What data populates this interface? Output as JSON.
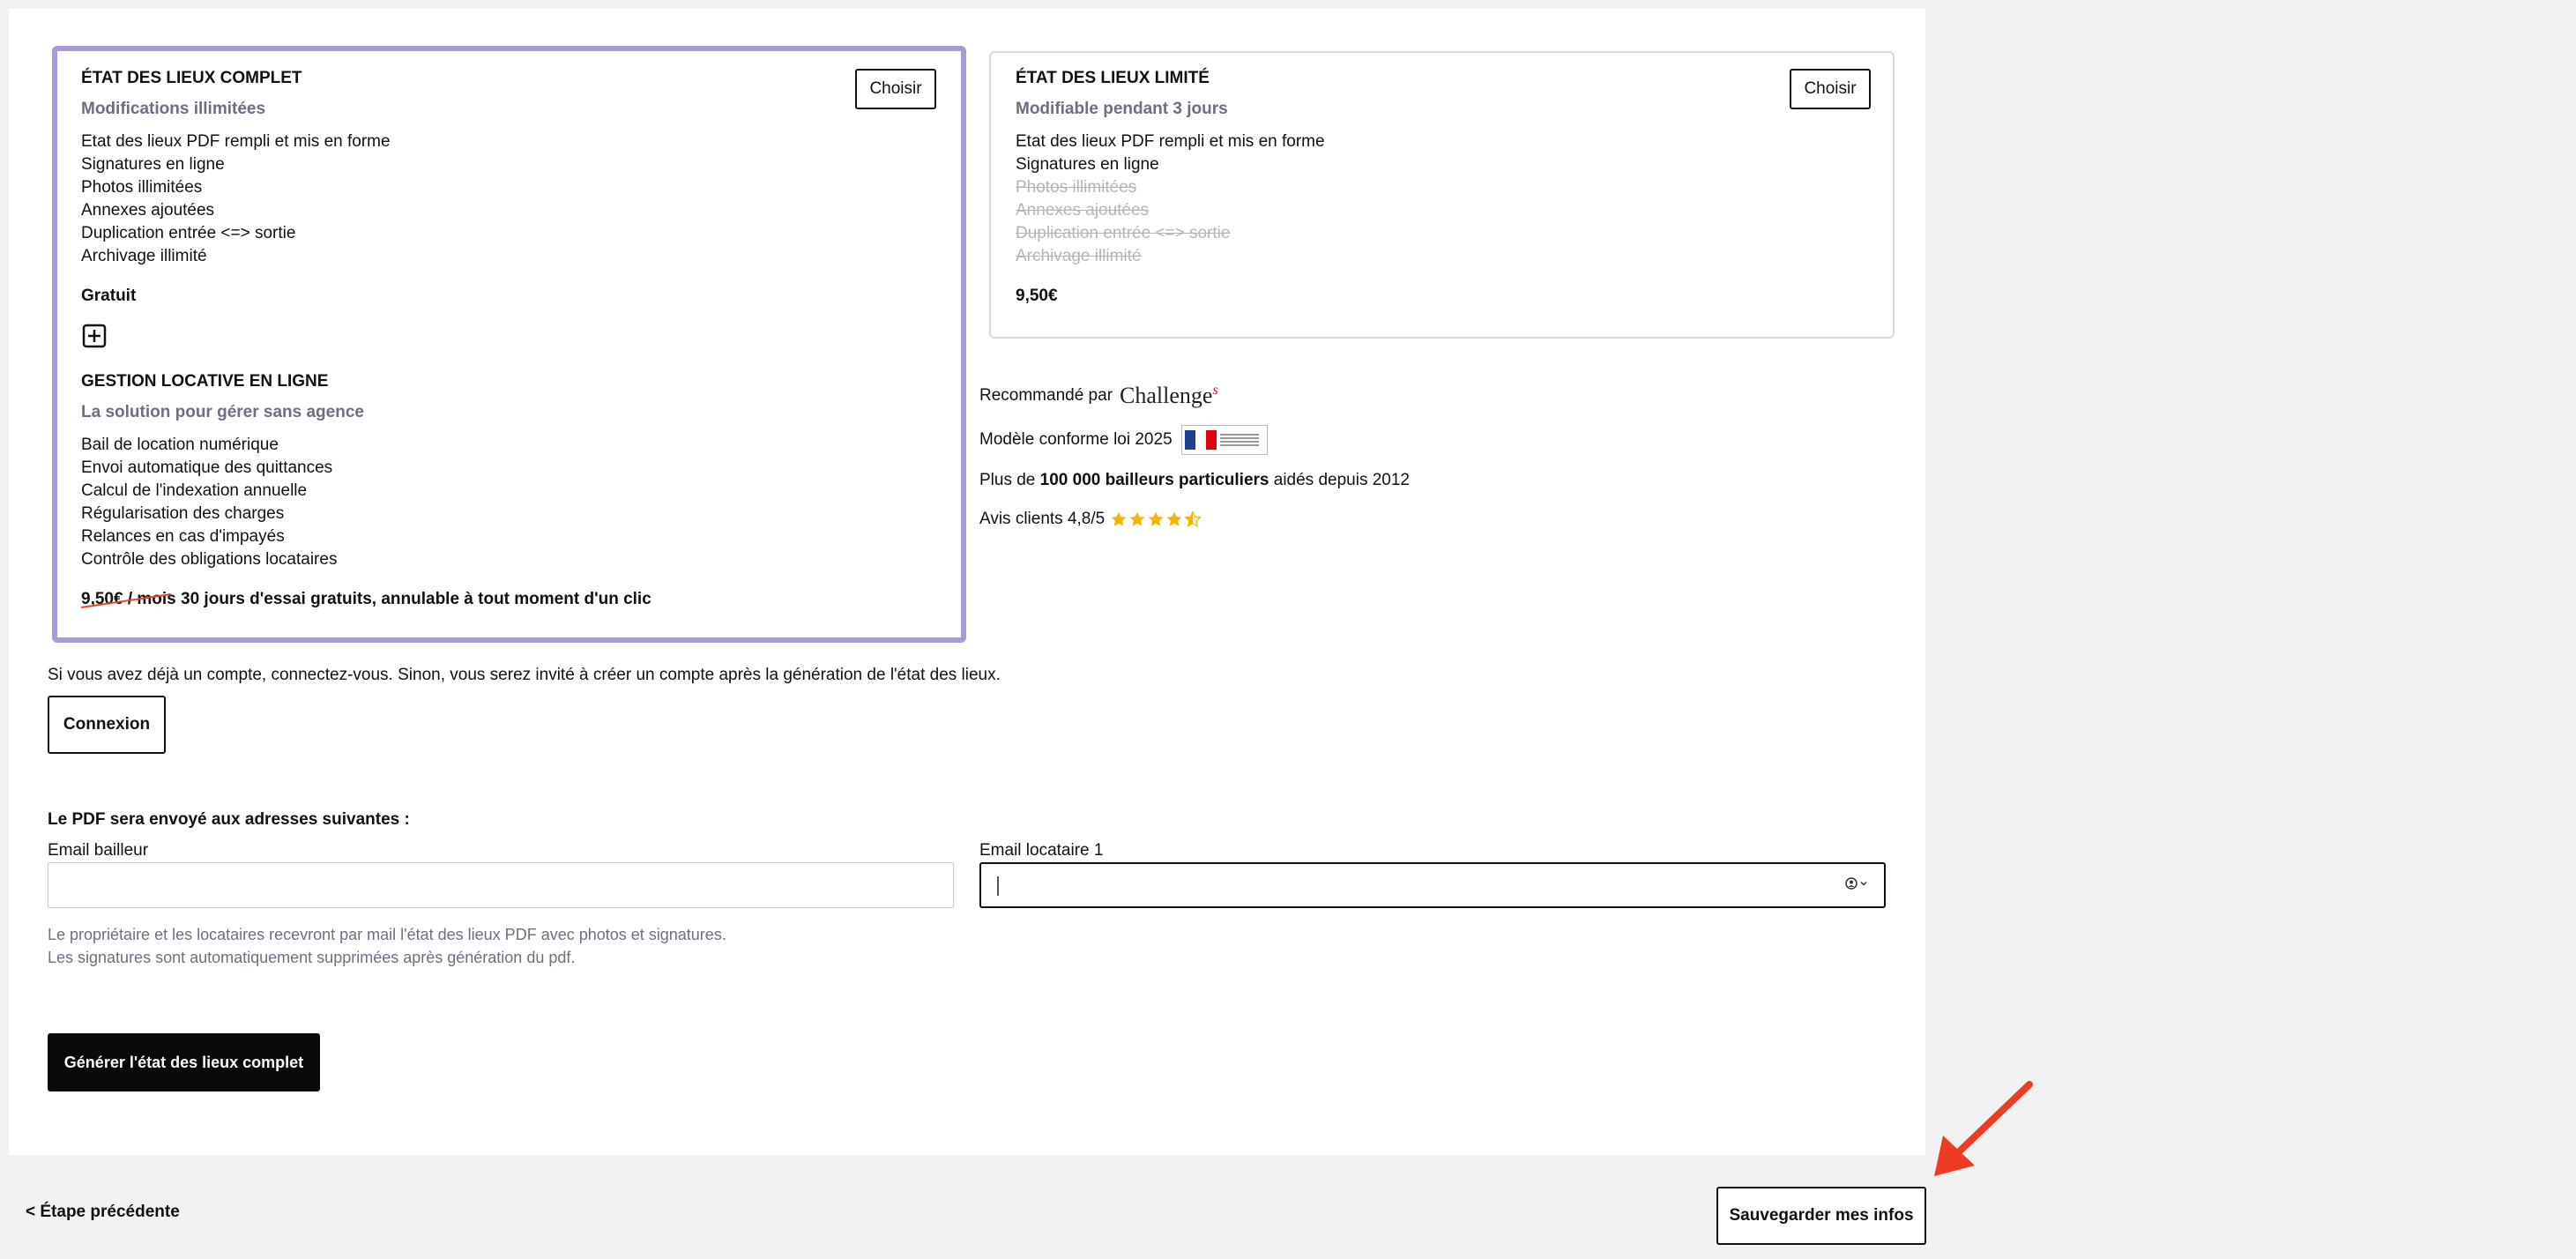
{
  "full_plan": {
    "title": "ÉTAT DES LIEUX COMPLET",
    "subtitle": "Modifications illimitées",
    "features": [
      "Etat des lieux PDF rempli et mis en forme",
      "Signatures en ligne",
      "Photos illimitées",
      "Annexes ajoutées",
      "Duplication entrée <=> sortie",
      "Archivage illimité"
    ],
    "price": "Gratuit",
    "choose_label": "Choisir",
    "addon": {
      "icon": "plus-square-icon",
      "title": "GESTION LOCATIVE EN LIGNE",
      "subtitle": "La solution pour gérer sans agence",
      "features": [
        "Bail de location numérique",
        "Envoi automatique des quittances",
        "Calcul de l'indexation annuelle",
        "Régularisation des charges",
        "Relances en cas d'impayés",
        "Contrôle des obligations locataires"
      ],
      "old_price": "9,50€ / mois",
      "offer": "30 jours d'essai gratuits, annulable à tout moment d'un clic"
    }
  },
  "limited_plan": {
    "title": "ÉTAT DES LIEUX LIMITÉ",
    "subtitle": "Modifiable pendant 3 jours",
    "features_included": [
      "Etat des lieux PDF rempli et mis en forme",
      "Signatures en ligne"
    ],
    "features_excluded": [
      "Photos illimitées",
      "Annexes ajoutées",
      "Duplication entrée <=> sortie",
      "Archivage illimité"
    ],
    "price": "9,50€",
    "choose_label": "Choisir"
  },
  "trust": {
    "recommended_prefix": "Recommandé par",
    "recommended_logo": "Challenges",
    "compliance": "Modèle conforme loi 2025",
    "landlords_prefix": "Plus de",
    "landlords_bold": "100 000 bailleurs particuliers",
    "landlords_suffix": "aidés depuis 2012",
    "reviews": "Avis clients 4,8/5",
    "rating": 4.5
  },
  "account": {
    "text": "Si vous avez déjà un compte, connectez-vous. Sinon, vous serez invité à créer un compte après la génération de l'état des lieux.",
    "login_label": "Connexion"
  },
  "emails": {
    "heading": "Le PDF sera envoyé aux adresses suivantes :",
    "landlord_label": "Email bailleur",
    "landlord_value": "",
    "tenant_label": "Email locataire 1",
    "tenant_value": "",
    "note_line1": "Le propriétaire et les locataires recevront par mail l'état des lieux PDF avec photos et signatures.",
    "note_line2": "Les signatures sont automatiquement supprimées après génération du pdf."
  },
  "generate_label": "Générer l'état des lieux complet",
  "footer": {
    "back_label": "< Étape précédente",
    "save_label": "Sauvegarder mes infos"
  },
  "colors": {
    "selected_border": "#a99ad6",
    "subtitle": "#6e6e80",
    "star": "#f5b400",
    "arrow": "#ef3b24"
  }
}
